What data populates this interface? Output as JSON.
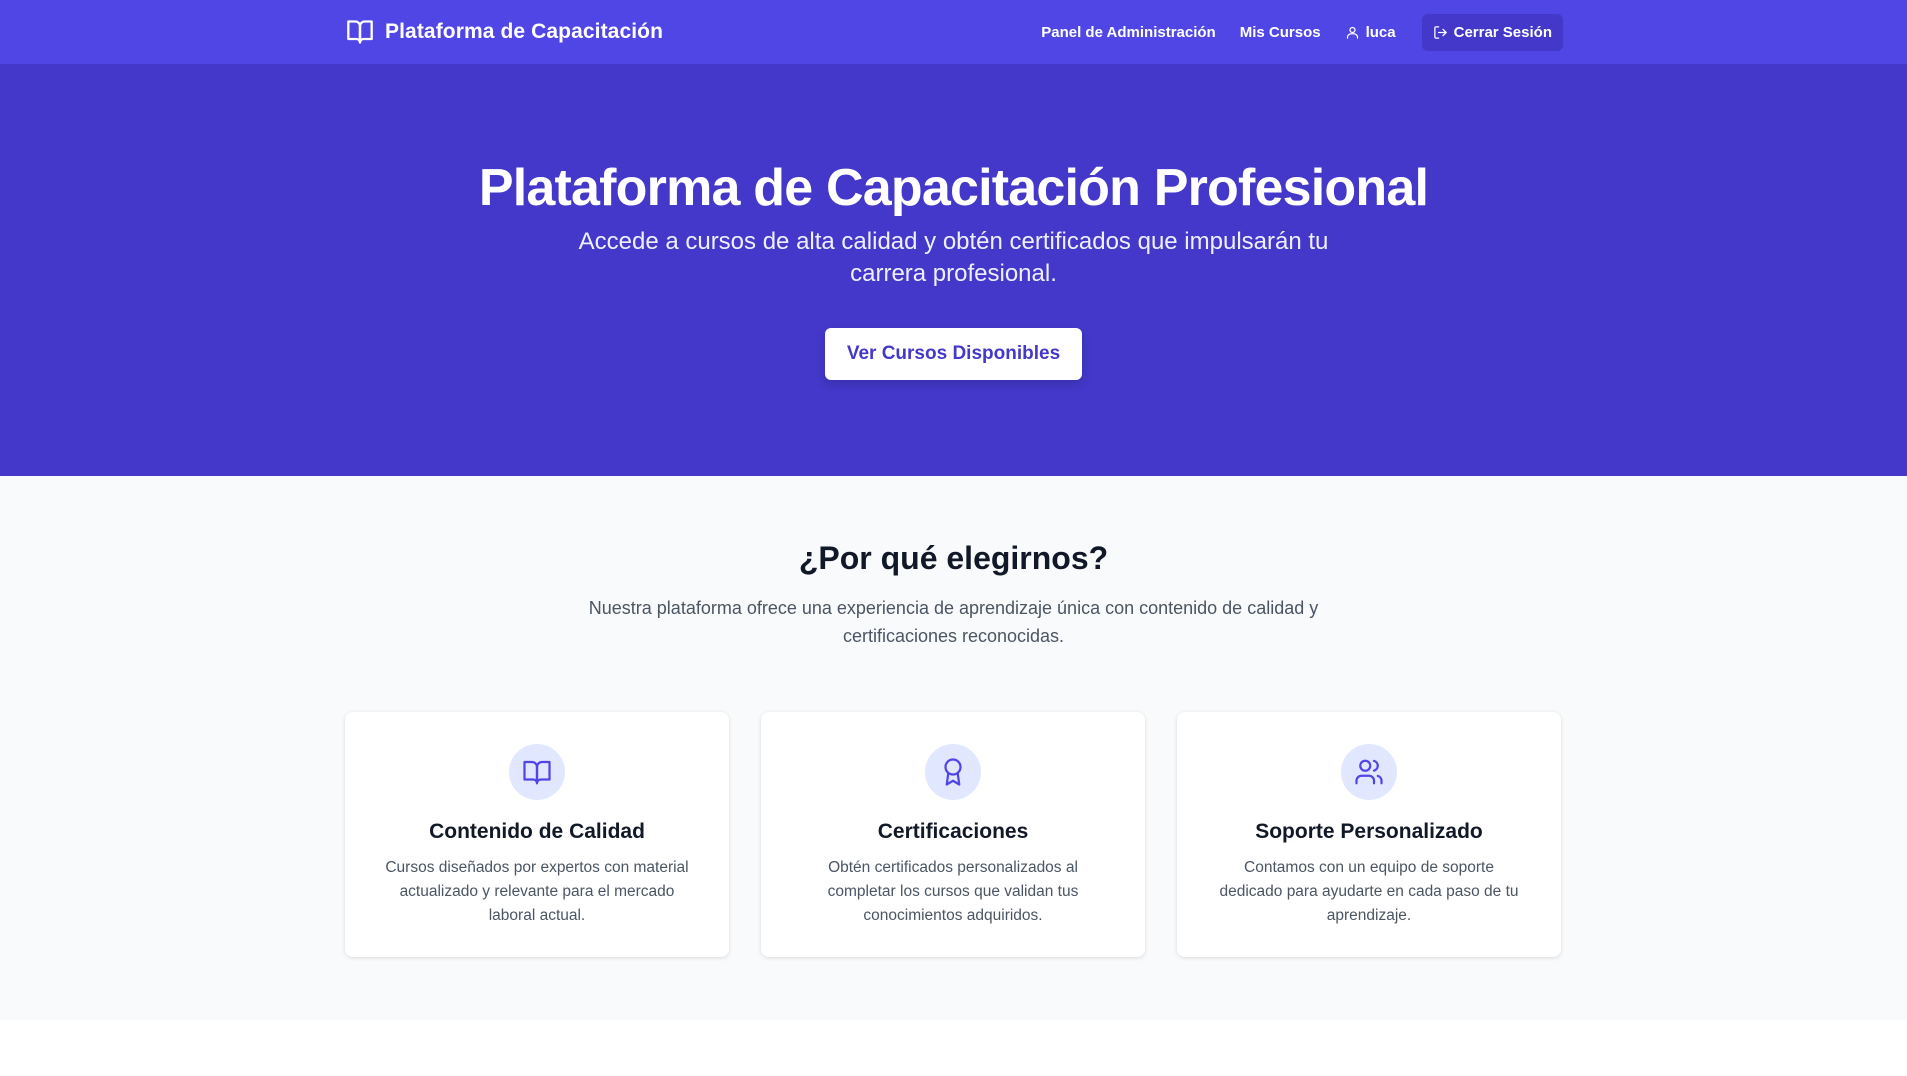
{
  "nav": {
    "brand_title": "Plataforma de Capacitación",
    "brand_icon": "book-open-icon",
    "links": [
      {
        "label": "Panel de Administración"
      },
      {
        "label": "Mis Cursos"
      }
    ],
    "user_name": "luca",
    "user_icon": "user-icon",
    "logout_label": "Cerrar Sesión",
    "logout_icon": "log-out-icon"
  },
  "hero": {
    "title": "Plataforma de Capacitación Profesional",
    "subtitle": "Accede a cursos de alta calidad y obtén certificados que impulsarán tu carrera profesional.",
    "cta_label": "Ver Cursos Disponibles"
  },
  "features": {
    "title": "¿Por qué elegirnos?",
    "description": "Nuestra plataforma ofrece una experiencia de aprendizaje única con contenido de calidad y certificaciones reconocidas.",
    "cards": [
      {
        "icon": "book-open-icon",
        "title": "Contenido de Calidad",
        "text": "Cursos diseñados por expertos con material actualizado y relevante para el mercado laboral actual."
      },
      {
        "icon": "award-icon",
        "title": "Certificaciones",
        "text": "Obtén certificados personalizados al completar los cursos que validan tus conocimientos adquiridos."
      },
      {
        "icon": "users-icon",
        "title": "Soporte Personalizado",
        "text": "Contamos con un equipo de soporte dedicado para ayudarte en cada paso de tu aprendizaje."
      }
    ]
  },
  "colors": {
    "navbar": "#4f46e5",
    "hero": "#4338ca",
    "accent": "#4f46e5",
    "icon_bg": "#e0e7ff",
    "section_bg": "#f9fafb"
  }
}
